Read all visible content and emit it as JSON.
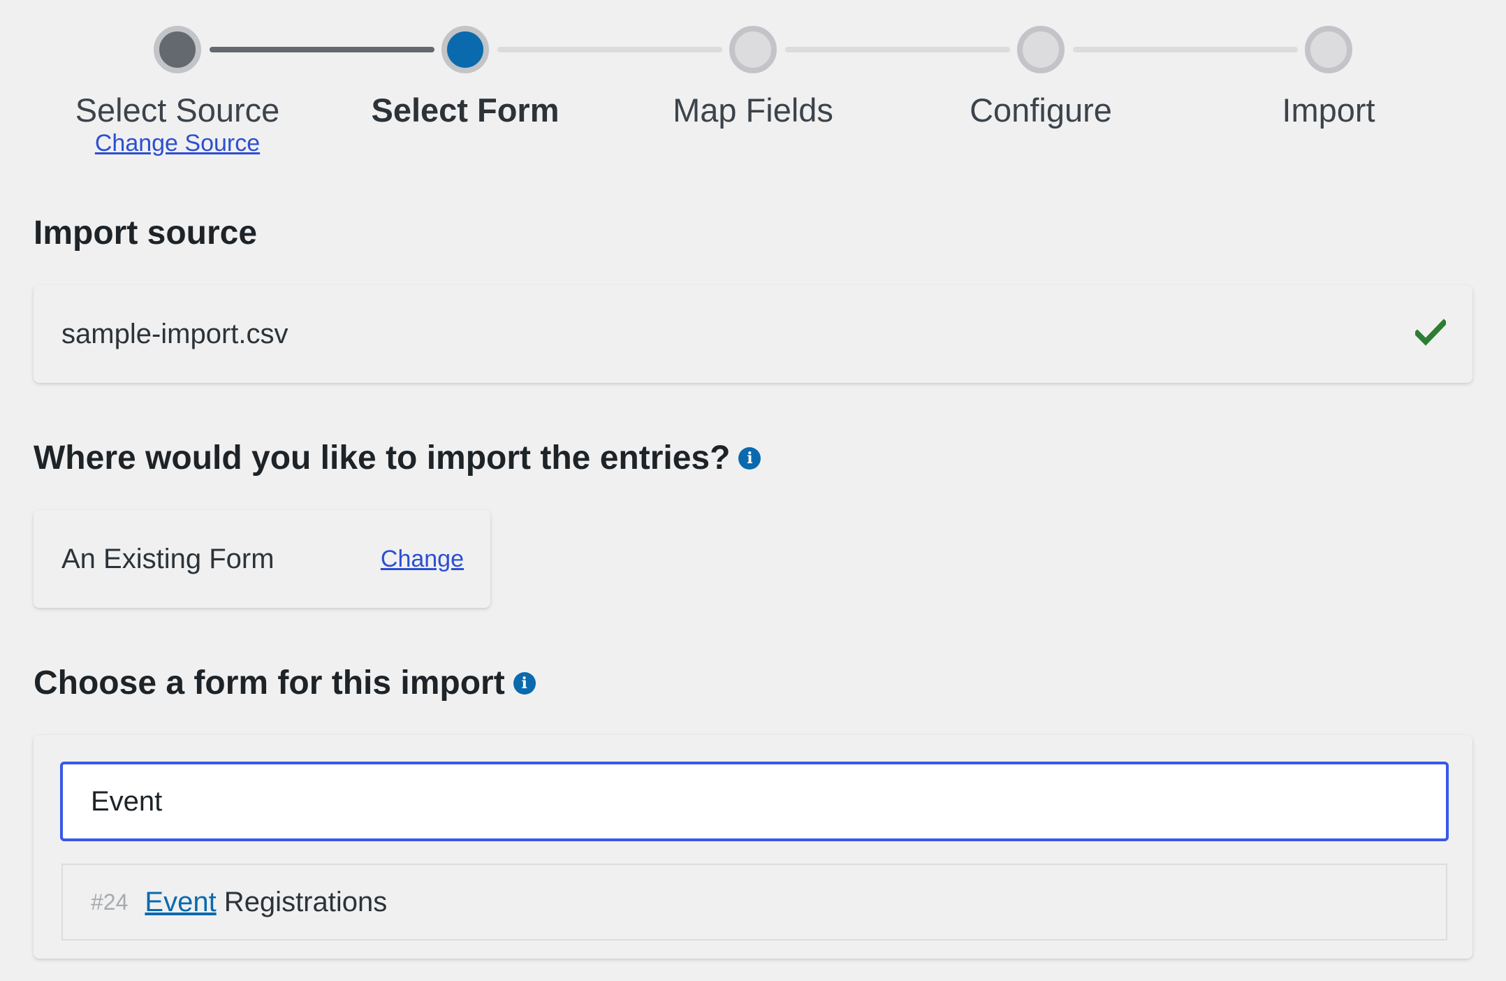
{
  "stepper": {
    "steps": [
      {
        "label": "Select Source",
        "state": "done"
      },
      {
        "label": "Select Form",
        "state": "active"
      },
      {
        "label": "Map Fields",
        "state": "todo"
      },
      {
        "label": "Configure",
        "state": "todo"
      },
      {
        "label": "Import",
        "state": "todo"
      }
    ],
    "change_source_label": "Change Source"
  },
  "import_source": {
    "heading": "Import source",
    "file_name": "sample-import.csv",
    "status_icon": "check-icon"
  },
  "destination": {
    "heading": "Where would you like to import the entries?",
    "info_icon": "info-icon",
    "selection": "An Existing Form",
    "change_label": "Change"
  },
  "form_choice": {
    "heading": "Choose a form for this import",
    "info_icon": "info-icon",
    "search_value": "Event",
    "results": [
      {
        "id": "#24",
        "match": "Event",
        "rest": " Registrations"
      }
    ]
  },
  "colors": {
    "accent": "#0a6aad",
    "link": "#2c4fd1",
    "focus": "#3858e9",
    "success": "#2e7d32"
  }
}
